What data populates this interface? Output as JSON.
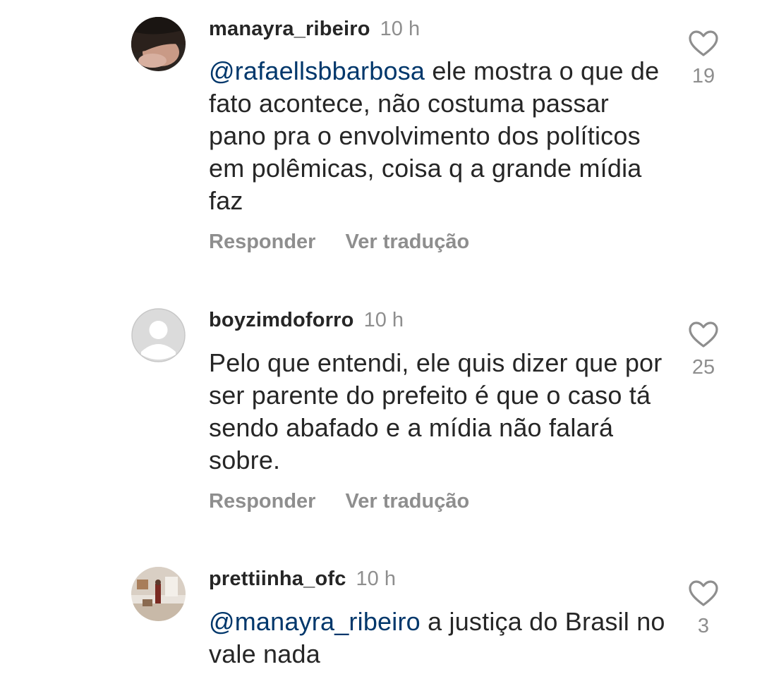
{
  "comments": [
    {
      "username": "manayra_ribeiro",
      "time": "10 h",
      "mention": "@rafaellsbbarbosa",
      "text_after_mention": " ele mostra o que de fato acontece, não costuma passar pano pra o envolvimento dos políticos em polêmicas, coisa q a grande mídia faz",
      "reply_label": "Responder",
      "translate_label": "Ver tradução",
      "likes": "19"
    },
    {
      "username": "boyzimdoforro",
      "time": "10 h",
      "mention": "",
      "text_after_mention": "Pelo que entendi, ele quis dizer que por ser parente do prefeito é que o caso tá sendo abafado e a mídia não falará sobre.",
      "reply_label": "Responder",
      "translate_label": "Ver tradução",
      "likes": "25"
    },
    {
      "username": "prettiinha_ofc",
      "time": "10 h",
      "mention": "@manayra_ribeiro",
      "text_after_mention": " a justiça do Brasil no vale nada",
      "likes": "3"
    }
  ],
  "icons": {
    "like": "heart-outline-icon",
    "default_avatar": "person-silhouette-icon"
  },
  "colors": {
    "mention": "#00376b",
    "secondary_text": "#8e8e8e",
    "primary_text": "#262626"
  }
}
